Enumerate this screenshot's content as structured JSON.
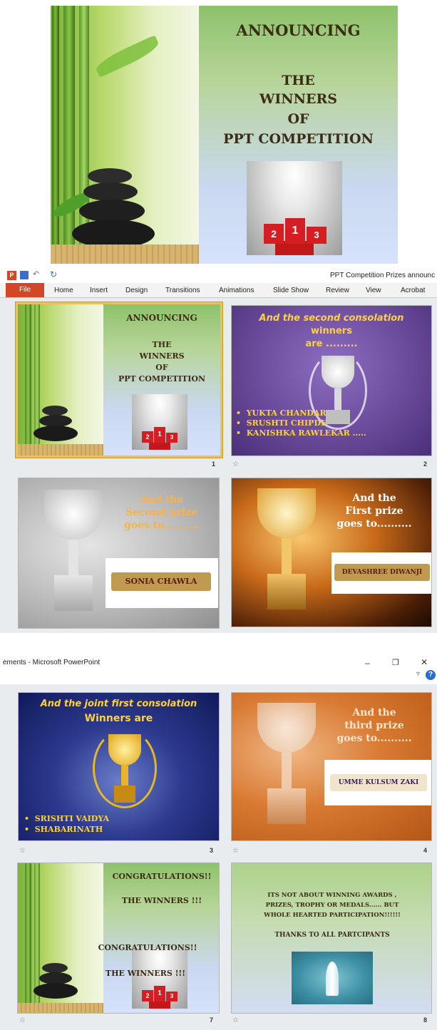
{
  "title_slide": {
    "line1": "ANNOUNCING",
    "line2": "THE",
    "line3": "WINNERS",
    "line4": "OF",
    "line5": "PPT COMPETITION",
    "podium": [
      "2",
      "1",
      "3"
    ]
  },
  "window": {
    "title_right": "PPT Competition Prizes announc",
    "title_left": "ements - Microsoft PowerPoint"
  },
  "ribbon": {
    "tabs": [
      "File",
      "Home",
      "Insert",
      "Design",
      "Transitions",
      "Animations",
      "Slide Show",
      "Review",
      "View",
      "Acrobat"
    ]
  },
  "slides": {
    "s1": {
      "num": "1",
      "lines": [
        "ANNOUNCING",
        "THE",
        "WINNERS",
        "OF",
        "PPT COMPETITION"
      ],
      "podium": [
        "2",
        "1",
        "3"
      ]
    },
    "s2": {
      "num": "2",
      "title": "And the second consolation winners",
      "title_line1": "And the second consolation",
      "title_line2": "winners",
      "title_line3": "are .........",
      "winners": [
        "YUKTA CHANDAR",
        "SRUSHTI CHIPDE",
        "KANISHKA RAWLEKAR ....."
      ]
    },
    "s3": {
      "line1": "And the",
      "line2": "Second  prize",
      "line3": "goes to..........",
      "winner": "SONIA CHAWLA"
    },
    "s4": {
      "line1": "And the",
      "line2": "First prize",
      "line3": "goes to..........",
      "winner": "DEVASHREE DIWANJI"
    },
    "s5": {
      "num": "3",
      "line1": "And the joint first consolation",
      "line2": "Winners are",
      "winners": [
        "SRISHTI  VAIDYA",
        "SHABARINATH"
      ]
    },
    "s6": {
      "num": "4",
      "line1": "And the",
      "line2": "third prize",
      "line3": "goes to..........",
      "winner": "UMME KULSUM ZAKI"
    },
    "s7": {
      "num": "7",
      "line1": "CONGRATULATIONS!!",
      "line2": "THE  WINNERS !!!",
      "line3": "CONGRATULATIONS!!",
      "line4": "THE  WINNERS !!!",
      "podium": [
        "2",
        "1",
        "3"
      ]
    },
    "s8": {
      "num": "8",
      "line1": "ITS  NOT ABOUT WINNING AWARDS ,",
      "line2": "PRIZES, TROPHY OR MEDALS......  BUT",
      "line3": "WHOLE HEARTED  PARTICIPATION!!!!!!",
      "line4": "THANKS  TO ALL PARTCIPANTS"
    }
  },
  "icons": {
    "star": "☆",
    "minimize": "–",
    "restore": "❐",
    "close": "✕",
    "help": "?",
    "caret": "▿"
  },
  "colors": {
    "file_tab": "#d24726",
    "selection": "#e9c25a"
  }
}
